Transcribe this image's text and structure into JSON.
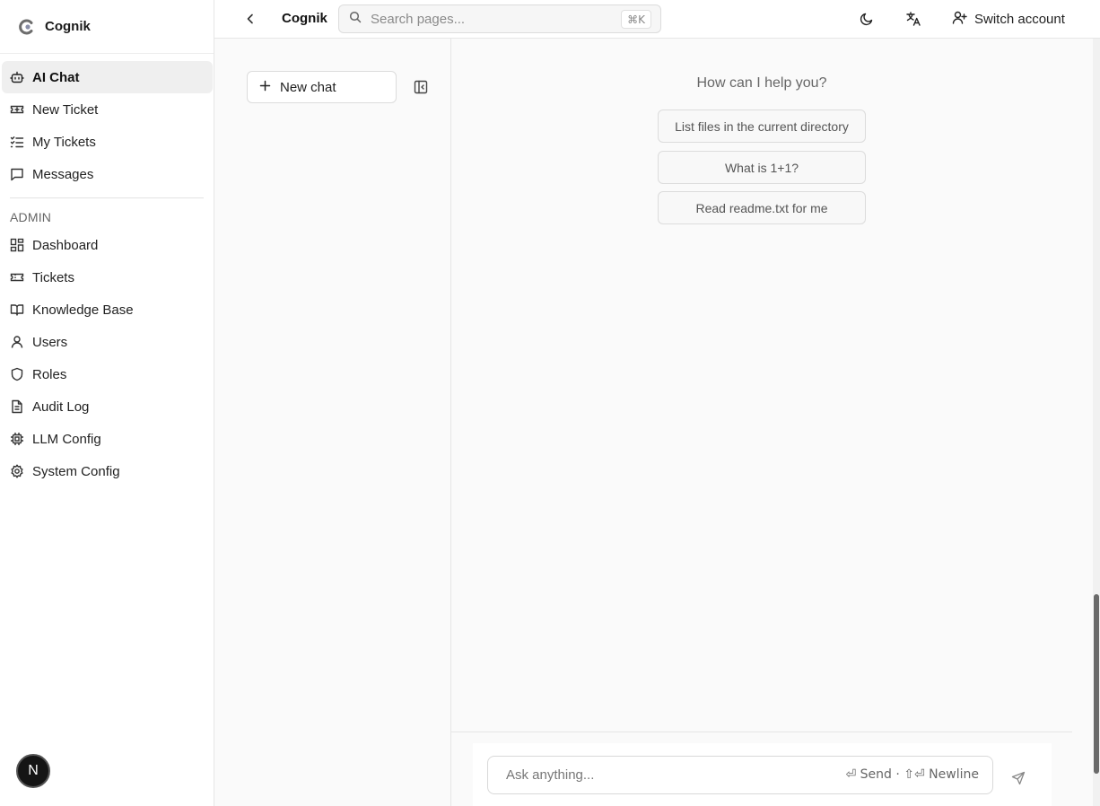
{
  "brand": {
    "name": "Cognik"
  },
  "sidebar": {
    "items": [
      {
        "label": "AI Chat",
        "icon": "bot-icon",
        "active": true
      },
      {
        "label": "New Ticket",
        "icon": "ticket-plus-icon"
      },
      {
        "label": "My Tickets",
        "icon": "list-checks-icon"
      },
      {
        "label": "Messages",
        "icon": "message-square-icon"
      }
    ],
    "admin_label": "ADMIN",
    "admin_items": [
      {
        "label": "Dashboard",
        "icon": "dashboard-icon"
      },
      {
        "label": "Tickets",
        "icon": "ticket-icon"
      },
      {
        "label": "Knowledge Base",
        "icon": "book-open-icon"
      },
      {
        "label": "Users",
        "icon": "user-icon"
      },
      {
        "label": "Roles",
        "icon": "shield-icon"
      },
      {
        "label": "Audit Log",
        "icon": "file-text-icon"
      },
      {
        "label": "LLM Config",
        "icon": "cpu-icon"
      },
      {
        "label": "System Config",
        "icon": "gear-icon"
      }
    ],
    "avatar_initial": "N"
  },
  "header": {
    "title": "Cognik",
    "search_placeholder": "Search pages...",
    "search_shortcut": "⌘K",
    "switch_account_label": "Switch account"
  },
  "chat": {
    "new_chat_label": "New chat",
    "welcome": "How can I help you?",
    "suggestions": [
      "List files in the current directory",
      "What is 1+1?",
      "Read readme.txt for me"
    ],
    "input_placeholder": "Ask anything...",
    "input_hint": "⏎ Send · ⇧⏎ Newline"
  },
  "colors": {
    "accent": "#111111",
    "active_bg": "#efefef",
    "border": "#dcdcdc"
  }
}
